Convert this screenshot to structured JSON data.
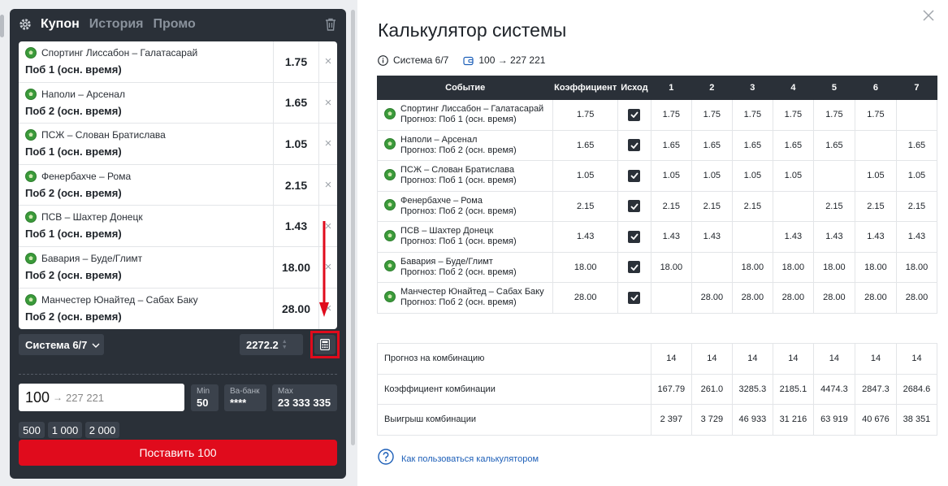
{
  "coupon": {
    "tabs": [
      "Купон",
      "История",
      "Промо"
    ],
    "bets": [
      {
        "match": "Спортинг Лиссабон – Галатасарай",
        "outcome": "Поб 1 (осн. время)",
        "odd": "1.75"
      },
      {
        "match": "Наполи – Арсенал",
        "outcome": "Поб 2 (осн. время)",
        "odd": "1.65"
      },
      {
        "match": "ПСЖ – Слован Братислава",
        "outcome": "Поб 1 (осн. время)",
        "odd": "1.05"
      },
      {
        "match": "Фенербахче – Рома",
        "outcome": "Поб 2 (осн. время)",
        "odd": "2.15"
      },
      {
        "match": "ПСВ – Шахтер Донецк",
        "outcome": "Поб 1 (осн. время)",
        "odd": "1.43"
      },
      {
        "match": "Бавария – Буде/Глимт",
        "outcome": "Поб 2 (осн. время)",
        "odd": "18.00"
      },
      {
        "match": "Манчестер Юнайтед – Сабах Баку",
        "outcome": "Поб 2 (осн. время)",
        "odd": "28.00"
      }
    ],
    "remove_symbol": "×",
    "system_label": "Система 6/7",
    "total_odd": "2272.2",
    "stake": {
      "value": "100",
      "arrow": "→",
      "win": "227 221"
    },
    "limits": {
      "min_label": "Min",
      "min_value": "50",
      "vabank_label": "Ва-банк",
      "vabank_value": "****",
      "max_label": "Max",
      "max_value": "23 333 335"
    },
    "quick_stakes": [
      "500",
      "1 000",
      "2 000"
    ],
    "place_button": "Поставить 100"
  },
  "calculator": {
    "title": "Калькулятор системы",
    "system": "Система 6/7",
    "stake_info": "100 → 227 221",
    "headers": [
      "Событие",
      "Коэффициент",
      "Исход",
      "1",
      "2",
      "3",
      "4",
      "5",
      "6",
      "7"
    ],
    "rows": [
      {
        "match": "Спортинг Лиссабон – Галатасарай",
        "forecast": "Прогноз: Поб 1 (осн. время)",
        "odd": "1.75",
        "cols": [
          "1.75",
          "1.75",
          "1.75",
          "1.75",
          "1.75",
          "1.75",
          ""
        ]
      },
      {
        "match": "Наполи – Арсенал",
        "forecast": "Прогноз: Поб 2 (осн. время)",
        "odd": "1.65",
        "cols": [
          "1.65",
          "1.65",
          "1.65",
          "1.65",
          "1.65",
          "",
          "1.65"
        ]
      },
      {
        "match": "ПСЖ – Слован Братислава",
        "forecast": "Прогноз: Поб 1 (осн. время)",
        "odd": "1.05",
        "cols": [
          "1.05",
          "1.05",
          "1.05",
          "1.05",
          "",
          "1.05",
          "1.05"
        ]
      },
      {
        "match": "Фенербахче – Рома",
        "forecast": "Прогноз: Поб 2 (осн. время)",
        "odd": "2.15",
        "cols": [
          "2.15",
          "2.15",
          "2.15",
          "",
          "2.15",
          "2.15",
          "2.15"
        ]
      },
      {
        "match": "ПСВ – Шахтер Донецк",
        "forecast": "Прогноз: Поб 1 (осн. время)",
        "odd": "1.43",
        "cols": [
          "1.43",
          "1.43",
          "",
          "1.43",
          "1.43",
          "1.43",
          "1.43"
        ]
      },
      {
        "match": "Бавария – Буде/Глимт",
        "forecast": "Прогноз: Поб 2 (осн. время)",
        "odd": "18.00",
        "cols": [
          "18.00",
          "",
          "18.00",
          "18.00",
          "18.00",
          "18.00",
          "18.00"
        ]
      },
      {
        "match": "Манчестер Юнайтед – Сабах Баку",
        "forecast": "Прогноз: Поб 2 (осн. время)",
        "odd": "28.00",
        "cols": [
          "",
          "28.00",
          "28.00",
          "28.00",
          "28.00",
          "28.00",
          "28.00"
        ]
      }
    ],
    "summary": [
      {
        "label": "Прогноз на комбинацию",
        "values": [
          "14",
          "14",
          "14",
          "14",
          "14",
          "14",
          "14"
        ]
      },
      {
        "label": "Коэффициент комбинации",
        "values": [
          "167.79",
          "261.0",
          "3285.3",
          "2185.1",
          "4474.3",
          "2847.3",
          "2684.6"
        ]
      },
      {
        "label": "Выигрыш комбинации",
        "values": [
          "2 397",
          "3 729",
          "46 933",
          "31 216",
          "63 919",
          "40 676",
          "38 351"
        ]
      }
    ],
    "help_link": "Как пользоваться калькулятором"
  }
}
